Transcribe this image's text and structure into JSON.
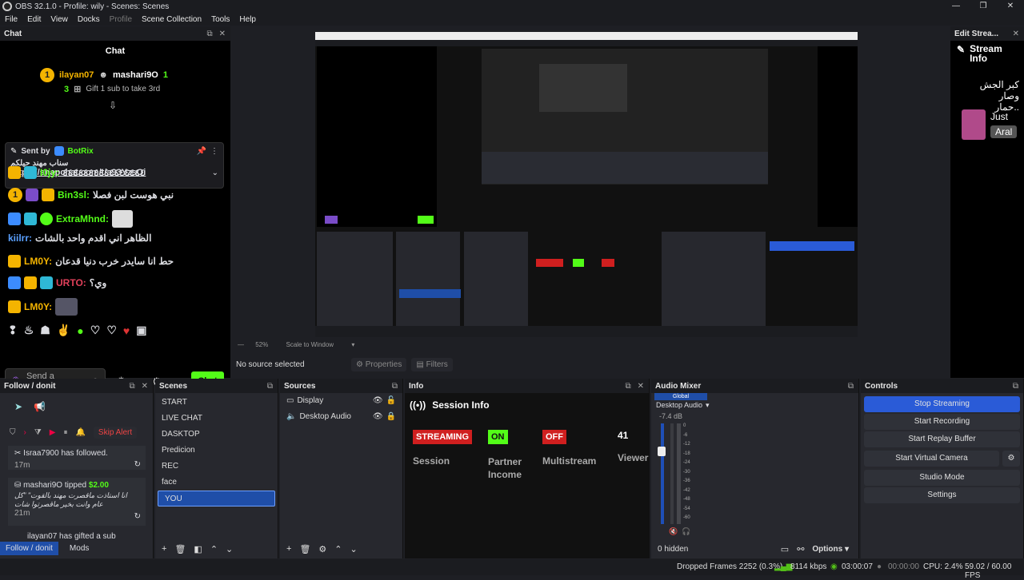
{
  "window": {
    "title": "OBS 32.1.0 - Profile: wily - Scenes: Scenes",
    "controls": [
      "—",
      "❐",
      "✕"
    ]
  },
  "menu": [
    "File",
    "Edit",
    "View",
    "Docks",
    "Profile",
    "Scene Collection",
    "Tools",
    "Help"
  ],
  "chat_dock": {
    "header": "Chat",
    "title": "Chat",
    "top_gifters": [
      {
        "rank": "1",
        "name": "ilayan07",
        "count": "3"
      },
      {
        "rank": "",
        "name": "mashari9O",
        "count": "1"
      }
    ],
    "gift_note": "Gift 1 sub to take 3rd",
    "pinned": {
      "sent_by_label": "Sent by",
      "sent_by": "BotRix",
      "text": "سناب مهند حيلكم",
      "link": "https://snapchat.com/t/a93YzsOi"
    },
    "messages": [
      {
        "user": "I0jy:",
        "text": "٤٤٤٤٤٤٤٤٤٤٤٤٤٤٤٤",
        "color": "#53fc18"
      },
      {
        "user": "Bin3sl:",
        "text": "نبي هوست لبن فصلا",
        "color": "#53fc18"
      },
      {
        "user": "ExtraMhnd:",
        "text": "",
        "color": "#53fc18"
      },
      {
        "user": "kiilrr:",
        "text": "الظاهر اني اقدم واحد بالشات",
        "color": "#5aa0ff"
      },
      {
        "user": "LM0Y:",
        "text": "حط انا سايدر خرب دنيا قدعان",
        "color": "#f4b400"
      },
      {
        "user": "URTO:",
        "text": "وي؟",
        "color": "#e0405a"
      },
      {
        "user": "LM0Y:",
        "text": "",
        "color": "#f4b400"
      }
    ],
    "input_placeholder": "Send a message",
    "chat_button": "Chat"
  },
  "preview": {
    "zoom": "52%",
    "scale_mode": "Scale to Window"
  },
  "selection_bar": {
    "no_source": "No source selected",
    "properties": "Properties",
    "filters": "Filters"
  },
  "edit_stream": {
    "header": "Edit Strea...",
    "title": "Stream Info",
    "arabic_line1": "كبر الجش",
    "arabic_line2": "وصار حمار..",
    "just": "Just",
    "aral": "Aral"
  },
  "follow_dock": {
    "header": "Follow / donit",
    "skip_alert": "Skip Alert",
    "events": [
      {
        "user": "Israa7900",
        "text": "has followed.",
        "time": "17m"
      },
      {
        "user": "mashari9O",
        "text": "tipped",
        "amount": "$2.00",
        "note": "انا استاذت ماقصرت مهند بالقوت\" \"كل عام وانت بخير ماقصرتوا شات",
        "time": "21m"
      },
      {
        "user": "ilayan07",
        "text": "has gifted a sub",
        "time": ""
      }
    ],
    "tabs": [
      "Follow / donit",
      "Mods"
    ]
  },
  "scenes": {
    "header": "Scenes",
    "items": [
      "START",
      "LIVE CHAT",
      "DASKTOP",
      "Predicion",
      "REC",
      "face",
      "YOU"
    ],
    "selected": "YOU"
  },
  "sources": {
    "header": "Sources",
    "items": [
      "Display",
      "Desktop Audio"
    ]
  },
  "info": {
    "header": "Info",
    "title": "Session Info",
    "streaming": "STREAMING",
    "on": "ON",
    "off": "OFF",
    "viewers_count": "41",
    "session": "Session",
    "partner_income": "Partner Income",
    "multistream": "Multistream",
    "viewers": "Viewer"
  },
  "audio_mixer": {
    "header": "Audio Mixer",
    "global": "Global",
    "device": "Desktop Audio",
    "level": "-7.4 dB",
    "ticks": [
      "0",
      "-6",
      "-12",
      "-18",
      "-24",
      "-30",
      "-36",
      "-42",
      "-48",
      "-54",
      "-60"
    ],
    "hidden": "0 hidden",
    "options": "Options",
    "fader_fraction": 0.72
  },
  "controls": {
    "header": "Controls",
    "buttons": [
      "Stop Streaming",
      "Start Recording",
      "Start Replay Buffer",
      "Start Virtual Camera",
      "Studio Mode",
      "Settings"
    ]
  },
  "status": {
    "dropped": "Dropped Frames 2252 (0.3%)",
    "bitrate": "8114 kbps",
    "stream_time": "03:00:07",
    "rec_time": "00:00:00",
    "cpu": "CPU: 2.4%",
    "fps": "59.02 / 60.00 FPS"
  },
  "colors": {
    "accent": "#2a5bd7",
    "kick_green": "#53fc18",
    "streaming_red": "#d01f1f",
    "scene_selected": "#1f4ea8"
  }
}
